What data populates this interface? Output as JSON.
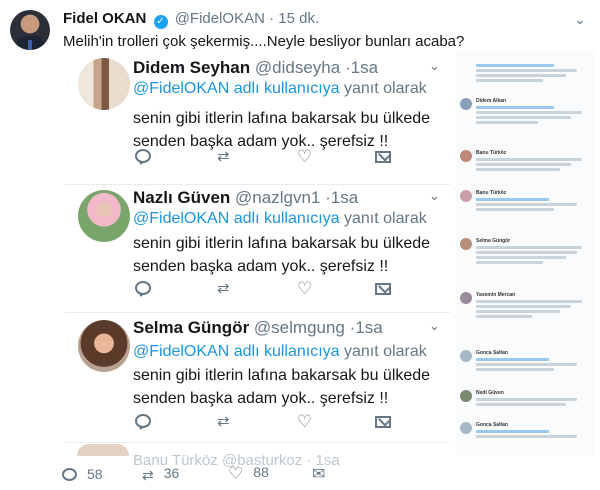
{
  "main_tweet": {
    "name": "Fidel OKAN",
    "verified_glyph": "✓",
    "handle": "@FidelOKAN",
    "dot": "·",
    "time": "15 dk.",
    "text": "Melih'in trolleri çok şekermiş....Neyle besliyor bunları acaba?",
    "menu_icon": "chevron-down-icon"
  },
  "replies": [
    {
      "name": "Didem Seyhan",
      "handle": "@didseyha",
      "dot": "·",
      "time": "1sa",
      "mention": "@FidelOKAN adlı kullanıcıya",
      "reply_to_suffix": "yanıt olarak",
      "body_line1": "senin gibi itlerin lafına bakarsak bu ülkede",
      "body_line2": "senden başka adam yok.. şerefsiz !!"
    },
    {
      "name": "Nazlı Güven",
      "handle": "@nazlgvn1",
      "dot": "·",
      "time": "1sa",
      "mention": "@FidelOKAN adlı kullanıcıya",
      "reply_to_suffix": "yanıt olarak",
      "body_line1": "senin gibi itlerin lafına bakarsak bu ülkede",
      "body_line2": "senden başka adam yok.. şerefsiz !!"
    },
    {
      "name": "Selma Güngör",
      "handle": "@selmgung",
      "dot": "·",
      "time": "1sa",
      "mention": "@FidelOKAN adlı kullanıcıya",
      "reply_to_suffix": "yanıt olarak",
      "body_line1": "senin gibi itlerin lafına bakarsak bu ülkede",
      "body_line2": "senden başka adam yok.. şerefsiz !!"
    }
  ],
  "reply_icons": [
    "reply-icon",
    "retweet-icon",
    "like-icon",
    "message-icon"
  ],
  "peek_reply": {
    "text": "Banu Türköz  @basturkoz · 1sa"
  },
  "thumbnail_names": [
    "Didem Alkan",
    "Banu Türköz",
    "Selma Güngör",
    "Yasemin Mercan",
    "Gonca Saltan",
    "Nedi Güven",
    "Gonca Saltan"
  ],
  "stats": {
    "replies": "58",
    "retweets": "36",
    "likes": "88",
    "retweet_glyph": "⇄",
    "like_glyph": "♡",
    "message_glyph": "✉"
  },
  "colors": {
    "link": "#1b95e0",
    "muted": "#657786",
    "verified": "#1da1f2"
  }
}
